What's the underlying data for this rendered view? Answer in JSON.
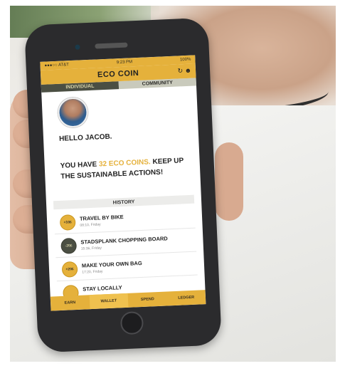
{
  "status": {
    "carrier": "●●●○○ AT&T",
    "time": "9:23 PM",
    "battery": "100%"
  },
  "app": {
    "title": "ECO COIN",
    "icons": "↻ ☻"
  },
  "tabs": [
    {
      "label": "INDIVIDUAL"
    },
    {
      "label": "COMMUNITY"
    }
  ],
  "greeting": "HELLO JACOB.",
  "message": {
    "prefix": "YOU HAVE ",
    "coins": "32 ECO COINS.",
    "suffix": "KEEP UP THE SUSTAINABLE ACTIONS!"
  },
  "history": {
    "title": "HISTORY",
    "items": [
      {
        "amount": "+10£",
        "name": "TRAVEL BY BIKE",
        "time": "08:10, Friday"
      },
      {
        "amount": "-20£",
        "name": "STADSPLANK CHOPPING BOARD",
        "time": "15:36, Friday"
      },
      {
        "amount": "+20£",
        "name": "MAKE YOUR OWN BAG",
        "time": "17:20, Friday"
      },
      {
        "amount": "",
        "name": "STAY LOCALLY",
        "time": ""
      }
    ]
  },
  "nav": [
    {
      "label": "EARN"
    },
    {
      "label": "WALLET"
    },
    {
      "label": "SPEND"
    },
    {
      "label": "LEDGER"
    }
  ],
  "colors": {
    "accent": "#e5b13b",
    "dark_tab": "#4b4f43"
  }
}
